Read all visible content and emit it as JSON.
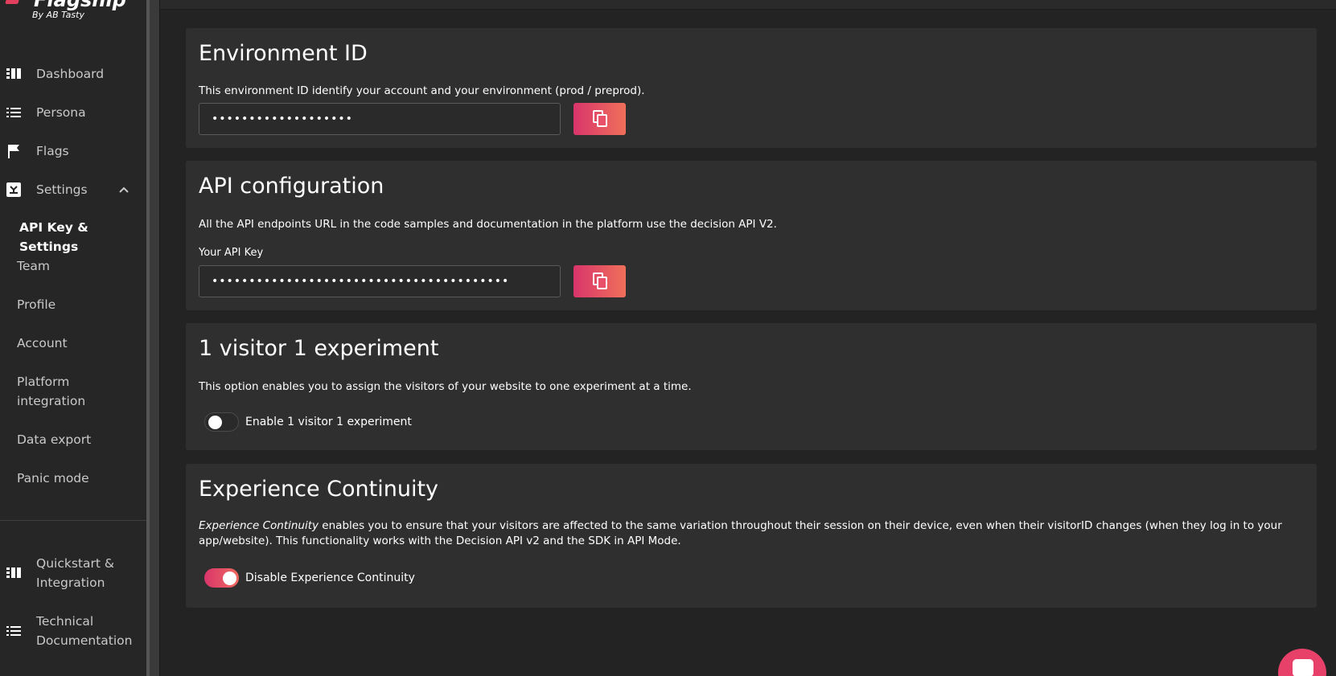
{
  "brand": {
    "name": "Flagship",
    "tagline": "By AB Tasty",
    "accent": "#e23e5d"
  },
  "sidebar": {
    "nav": [
      {
        "label": "Dashboard",
        "icon": "dashboard-icon"
      },
      {
        "label": "Persona",
        "icon": "list-icon"
      },
      {
        "label": "Flags",
        "icon": "flag-icon"
      },
      {
        "label": "Settings",
        "icon": "settings-icon"
      }
    ],
    "settings_sub": [
      {
        "label": "API Key & Settings",
        "active": true
      },
      {
        "label": "Team"
      },
      {
        "label": "Profile"
      },
      {
        "label": "Account"
      },
      {
        "label": "Platform integration"
      },
      {
        "label": "Data export"
      },
      {
        "label": "Panic mode"
      }
    ],
    "bottom": [
      {
        "label": "Quickstart & Integration",
        "icon": "quickstart-icon"
      },
      {
        "label": "Technical Documentation",
        "icon": "docs-icon"
      }
    ]
  },
  "sections": {
    "env": {
      "title": "Environment ID",
      "description": "This environment ID identify your account and your environment (prod / preprod).",
      "value": "•••••••••••••••••••"
    },
    "api": {
      "title": "API configuration",
      "description": "All the API endpoints URL in the code samples and documentation in the platform use the decision API V2.",
      "key_label": "Your API Key",
      "value": "••••••••••••••••••••••••••••••••••••••••"
    },
    "visitor": {
      "title": "1 visitor 1 experiment",
      "description": "This option enables you to assign the visitors of your website to one experiment at a time.",
      "toggle_label": "Enable 1 visitor 1 experiment",
      "enabled": false
    },
    "continuity": {
      "title": "Experience Continuity",
      "description_em": "Experience Continuity",
      "description_rest": " enables you to ensure that your visitors are affected to the same variation throughout their session on their device, even when their visitorID changes (when they log in to your app/website). This functionality works with the Decision API v2 and the SDK in API Mode.",
      "toggle_label": "Disable Experience Continuity",
      "enabled": true
    }
  }
}
